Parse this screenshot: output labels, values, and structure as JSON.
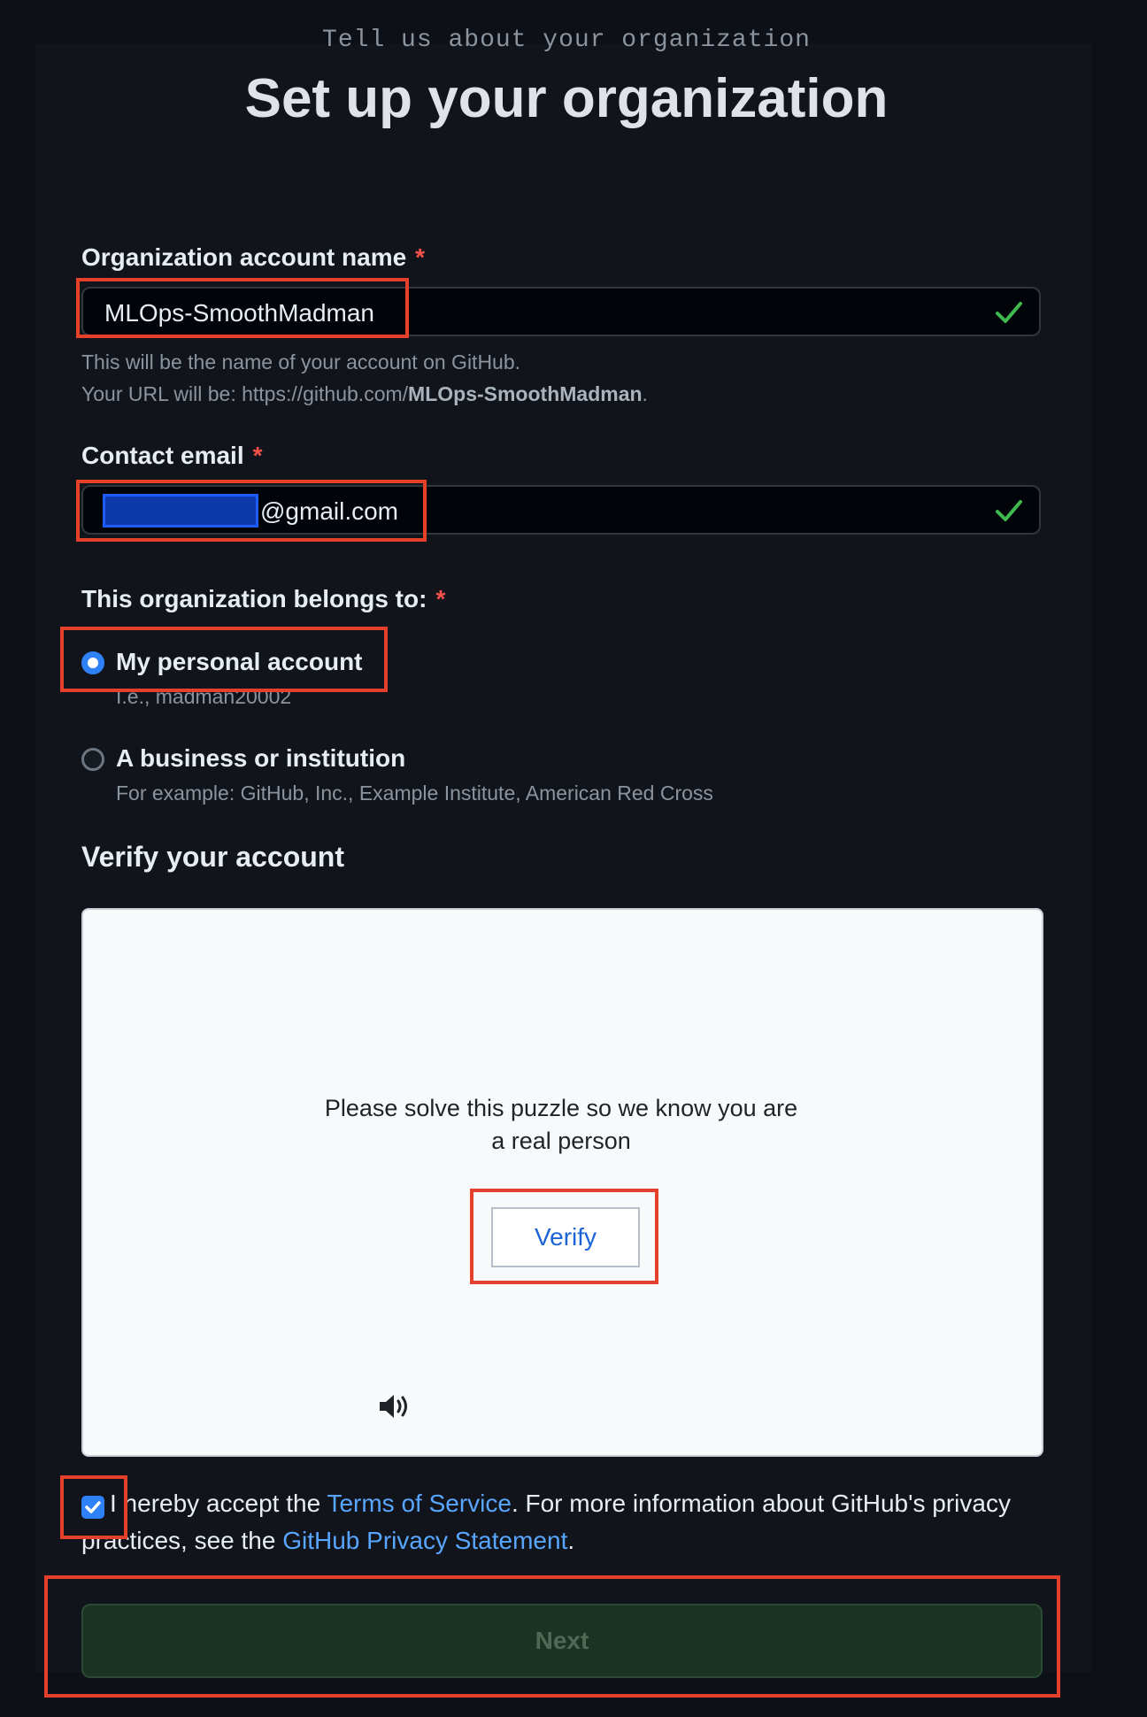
{
  "header": {
    "eyebrow": "Tell us about your organization",
    "title": "Set up your organization"
  },
  "form": {
    "org_name": {
      "label": "Organization account name",
      "required_mark": "*",
      "value": "MLOps-SmoothMadman",
      "hint_line1": "This will be the name of your account on GitHub.",
      "hint_url_prefix": "Your URL will be: https://github.com/",
      "hint_url_name": "MLOps-SmoothMadman",
      "hint_url_suffix": "."
    },
    "contact_email": {
      "label": "Contact email",
      "required_mark": "*",
      "value_visible": "@gmail.com"
    },
    "belongs_to": {
      "label": "This organization belongs to:",
      "required_mark": "*",
      "options": [
        {
          "title": "My personal account",
          "subtitle": "I.e., madman20002",
          "selected": true
        },
        {
          "title": "A business or institution",
          "subtitle": "For example: GitHub, Inc., Example Institute, American Red Cross",
          "selected": false
        }
      ]
    },
    "verify": {
      "heading": "Verify your account",
      "prompt": "Please solve this puzzle so we know you are a real person",
      "button_label": "Verify"
    },
    "terms": {
      "checked": true,
      "text_before": "I hereby accept the ",
      "tos_link": "Terms of Service",
      "text_middle": ". For more information about GitHub's privacy practices, see the ",
      "privacy_link": "GitHub Privacy Statement",
      "text_after": "."
    },
    "next_label": "Next"
  },
  "colors": {
    "highlight": "#e5402a",
    "accent_blue": "#2f81f7",
    "link_blue": "#58a6ff",
    "success_green": "#3fb950",
    "next_disabled_bg": "#1b3322"
  }
}
